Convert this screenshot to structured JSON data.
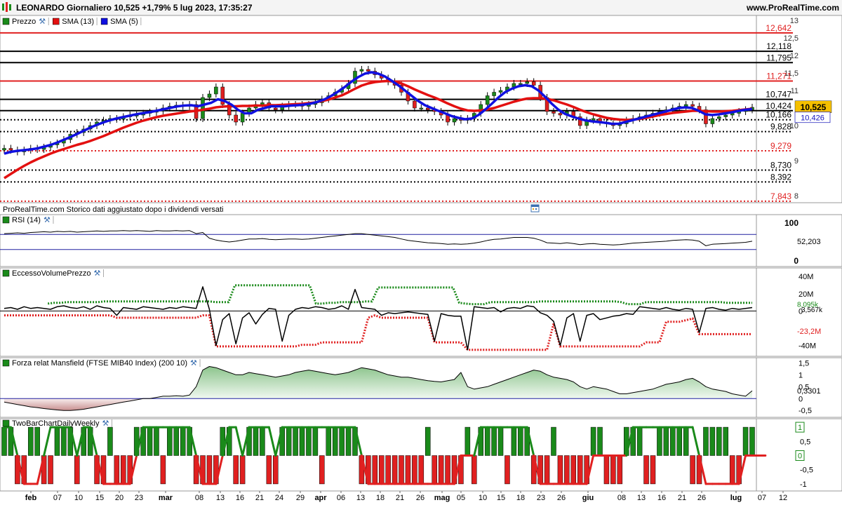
{
  "header": {
    "title": "LEONARDO Giornaliero 10,525 +1,79% 5 lug 2023, 17:35:27",
    "site": "www.ProRealTime.com"
  },
  "footer_note": "ProRealTime.com  Storico dati aggiustato dopo i dividendi versati",
  "x_axis_labels": [
    "feb",
    "07",
    "10",
    "15",
    "20",
    "23",
    "mar",
    "08",
    "13",
    "16",
    "21",
    "24",
    "29",
    "apr",
    "06",
    "13",
    "18",
    "21",
    "26",
    "mag",
    "05",
    "10",
    "15",
    "18",
    "23",
    "26",
    "giu",
    "08",
    "13",
    "16",
    "21",
    "26",
    "lug",
    "07",
    "12"
  ],
  "colors": {
    "up": "#1a8a1a",
    "down": "#e02020",
    "sma13": "#e31010",
    "sma5": "#1010e0",
    "accent": "#f5c000"
  },
  "chart_data": [
    {
      "type": "candlestick",
      "panel": "price",
      "legend": [
        {
          "name": "Prezzo"
        },
        {
          "name": "SMA (13)",
          "color": "#e31010"
        },
        {
          "name": "SMA (5)",
          "color": "#1010e0"
        }
      ],
      "y_ticks": [
        "13",
        "12,5",
        "12",
        "11,5",
        "11",
        "10",
        "9",
        "8"
      ],
      "ylim": [
        7.8,
        13.1
      ],
      "levels": [
        {
          "value": 12.642,
          "label": "12,642",
          "color": "#e02020",
          "style": "solid"
        },
        {
          "value": 12.118,
          "label": "12,118",
          "color": "#000",
          "style": "solid"
        },
        {
          "value": 11.795,
          "label": "11,795",
          "color": "#000",
          "style": "solid"
        },
        {
          "value": 11.271,
          "label": "11,271",
          "color": "#e02020",
          "style": "solid"
        },
        {
          "value": 10.747,
          "label": "10,747",
          "color": "#000",
          "style": "solid"
        },
        {
          "value": 10.424,
          "label": "10,424",
          "color": "#000",
          "style": "solid"
        },
        {
          "value": 10.166,
          "label": "10,166",
          "color": "#000",
          "style": "dotted"
        },
        {
          "value": 9.828,
          "label": "9,828",
          "color": "#000",
          "style": "dotted"
        },
        {
          "value": 9.279,
          "label": "9,279",
          "color": "#e02020",
          "style": "dotted"
        },
        {
          "value": 8.73,
          "label": "8,730",
          "color": "#000",
          "style": "dotted"
        },
        {
          "value": 8.392,
          "label": "8,392",
          "color": "#000",
          "style": "dotted"
        },
        {
          "value": 7.843,
          "label": "7,843",
          "color": "#e02020",
          "style": "dotted"
        }
      ],
      "last_price": {
        "value": 10.525,
        "label": "10,525"
      },
      "sma5_last": {
        "value": 10.426,
        "label": "10,426"
      },
      "close": [
        9.35,
        9.3,
        9.25,
        9.3,
        9.35,
        9.32,
        9.38,
        9.45,
        9.5,
        9.6,
        9.75,
        9.8,
        9.9,
        10.0,
        10.1,
        10.15,
        10.2,
        10.18,
        10.25,
        10.3,
        10.3,
        10.35,
        10.38,
        10.42,
        10.5,
        10.55,
        10.58,
        10.55,
        10.6,
        10.2,
        10.8,
        10.9,
        11.1,
        10.6,
        10.3,
        10.1,
        10.35,
        10.5,
        10.6,
        10.65,
        10.5,
        10.45,
        10.55,
        10.6,
        10.6,
        10.55,
        10.6,
        10.65,
        10.75,
        10.85,
        10.95,
        11.05,
        11.2,
        11.55,
        11.6,
        11.55,
        11.45,
        11.35,
        11.25,
        11.15,
        10.95,
        10.7,
        10.5,
        10.5,
        10.45,
        10.4,
        10.3,
        10.1,
        10.2,
        10.15,
        10.2,
        10.35,
        10.6,
        10.85,
        10.95,
        11.0,
        11.1,
        11.2,
        11.2,
        11.25,
        11.15,
        10.8,
        10.4,
        10.35,
        10.3,
        10.4,
        10.25,
        10.0,
        10.15,
        10.2,
        10.1,
        10.05,
        10.0,
        10.05,
        10.15,
        10.2,
        10.25,
        10.3,
        10.35,
        10.4,
        10.45,
        10.5,
        10.55,
        10.6,
        10.55,
        10.45,
        10.05,
        10.2,
        10.25,
        10.3,
        10.35,
        10.4,
        10.45,
        10.52
      ],
      "sma13": [
        8.5,
        8.62,
        8.74,
        8.85,
        8.95,
        9.04,
        9.12,
        9.2,
        9.27,
        9.33,
        9.39,
        9.45,
        9.5,
        9.56,
        9.63,
        9.7,
        9.78,
        9.86,
        9.94,
        10.01,
        10.08,
        10.14,
        10.19,
        10.24,
        10.28,
        10.31,
        10.34,
        10.37,
        10.4,
        10.42,
        10.45,
        10.48,
        10.52,
        10.54,
        10.55,
        10.55,
        10.56,
        10.56,
        10.57,
        10.57,
        10.58,
        10.58,
        10.59,
        10.6,
        10.61,
        10.62,
        10.64,
        10.66,
        10.7,
        10.74,
        10.8,
        10.86,
        10.95,
        11.05,
        11.14,
        11.2,
        11.24,
        11.26,
        11.27,
        11.25,
        11.2,
        11.12,
        11.03,
        10.95,
        10.87,
        10.8,
        10.72,
        10.63,
        10.55,
        10.48,
        10.43,
        10.42,
        10.43,
        10.46,
        10.5,
        10.56,
        10.62,
        10.68,
        10.73,
        10.77,
        10.78,
        10.78,
        10.76,
        10.72,
        10.66,
        10.6,
        10.53,
        10.45,
        10.38,
        10.32,
        10.27,
        10.22,
        10.19,
        10.17,
        10.16,
        10.17,
        10.19,
        10.22,
        10.26,
        10.3,
        10.33,
        10.36,
        10.38,
        10.4,
        10.42,
        10.42,
        10.41,
        10.4,
        10.4,
        10.41,
        10.42,
        10.44,
        10.46,
        10.48
      ],
      "sma5": [
        9.2,
        9.25,
        9.28,
        9.3,
        9.32,
        9.35,
        9.4,
        9.45,
        9.52,
        9.6,
        9.68,
        9.77,
        9.86,
        9.95,
        10.03,
        10.1,
        10.16,
        10.21,
        10.25,
        10.29,
        10.33,
        10.36,
        10.39,
        10.43,
        10.47,
        10.51,
        10.55,
        10.57,
        10.58,
        10.55,
        10.6,
        10.65,
        10.75,
        10.7,
        10.6,
        10.45,
        10.35,
        10.35,
        10.45,
        10.5,
        10.55,
        10.55,
        10.55,
        10.57,
        10.58,
        10.6,
        10.63,
        10.68,
        10.75,
        10.85,
        10.97,
        11.1,
        11.25,
        11.38,
        11.48,
        11.52,
        11.48,
        11.4,
        11.28,
        11.15,
        11.0,
        10.85,
        10.7,
        10.58,
        10.5,
        10.42,
        10.35,
        10.27,
        10.22,
        10.18,
        10.2,
        10.3,
        10.45,
        10.62,
        10.8,
        10.95,
        11.05,
        11.12,
        11.15,
        11.12,
        11.0,
        10.82,
        10.62,
        10.45,
        10.33,
        10.26,
        10.2,
        10.15,
        10.12,
        10.1,
        10.08,
        10.05,
        10.05,
        10.1,
        10.15,
        10.2,
        10.25,
        10.3,
        10.35,
        10.4,
        10.45,
        10.5,
        10.52,
        10.5,
        10.42,
        10.32,
        10.3,
        10.32,
        10.35,
        10.38,
        10.42,
        10.45,
        10.47
      ]
    },
    {
      "type": "line",
      "panel": "rsi",
      "legend": [
        {
          "name": "RSI (14)"
        }
      ],
      "y_ticks": [
        "100",
        "0"
      ],
      "ylim": [
        0,
        100
      ],
      "bands": [
        70,
        30
      ],
      "last": {
        "value": 52.203,
        "label": "52,203"
      },
      "values": [
        72,
        73,
        74,
        73,
        75,
        76,
        77,
        76,
        78,
        77,
        78,
        76,
        77,
        78,
        79,
        78,
        79,
        79,
        80,
        79,
        80,
        79,
        78,
        80,
        79,
        79,
        80,
        79,
        80,
        72,
        75,
        60,
        55,
        52,
        50,
        52,
        55,
        58,
        58,
        59,
        57,
        56,
        57,
        58,
        58,
        57,
        58,
        60,
        62,
        64,
        66,
        68,
        70,
        72,
        72,
        70,
        68,
        66,
        64,
        62,
        58,
        54,
        52,
        50,
        48,
        47,
        46,
        44,
        45,
        44,
        45,
        47,
        50,
        54,
        57,
        58,
        60,
        62,
        62,
        62,
        60,
        55,
        48,
        47,
        46,
        48,
        46,
        43,
        45,
        46,
        44,
        43,
        42,
        43,
        45,
        47,
        48,
        49,
        50,
        51,
        52,
        54,
        55,
        56,
        55,
        52,
        40,
        44,
        45,
        46,
        47,
        48,
        49,
        52
      ]
    },
    {
      "type": "line",
      "panel": "volume_excess",
      "legend": [
        {
          "name": "EccessoVolumePrezzo"
        }
      ],
      "y_ticks": [
        "40M",
        "20M",
        "0",
        "-40M"
      ],
      "ylim": [
        -50,
        45
      ],
      "labels": {
        "upper": "8,095k",
        "mid": "3,567k",
        "zero": "0",
        "lower": "-23,2M"
      },
      "values": [
        3,
        4,
        2,
        5,
        3,
        4,
        3,
        2,
        5,
        6,
        4,
        3,
        5,
        2,
        6,
        4,
        3,
        -5,
        4,
        3,
        2,
        5,
        4,
        3,
        2,
        4,
        3,
        5,
        4,
        3,
        28,
        2,
        -40,
        -10,
        -3,
        -38,
        -8,
        -2,
        -15,
        -4,
        3,
        2,
        -35,
        -5,
        2,
        4,
        3,
        5,
        4,
        2,
        3,
        6,
        2,
        25,
        4,
        3,
        2,
        -5,
        -2,
        -3,
        -2,
        -1,
        -2,
        -3,
        -4,
        -35,
        -3,
        -5,
        -6,
        -6,
        -45,
        5,
        4,
        3,
        4,
        -1,
        3,
        4,
        3,
        6,
        5,
        -2,
        -5,
        -12,
        -40,
        -8,
        -3,
        -35,
        -5,
        -3,
        -10,
        -8,
        -6,
        -5,
        -3,
        -4,
        5,
        4,
        3,
        2,
        4,
        2,
        1,
        3,
        2,
        -25,
        3,
        4,
        2,
        1,
        3,
        2,
        3,
        4
      ]
    },
    {
      "type": "area",
      "panel": "mansfield",
      "legend": [
        {
          "name": "Forza relat Mansfield (FTSE MIB40 Index) (200 10)"
        }
      ],
      "y_ticks": [
        "1,5",
        "1",
        "0,5",
        "0",
        "-0,5"
      ],
      "ylim": [
        -0.7,
        1.6
      ],
      "last": {
        "value": 0.3301,
        "label": "0,3301"
      },
      "values": [
        -0.15,
        -0.2,
        -0.25,
        -0.3,
        -0.35,
        -0.38,
        -0.42,
        -0.45,
        -0.48,
        -0.5,
        -0.5,
        -0.48,
        -0.45,
        -0.4,
        -0.35,
        -0.3,
        -0.25,
        -0.2,
        -0.15,
        -0.1,
        -0.05,
        0.0,
        0.0,
        0.05,
        0.1,
        0.1,
        0.12,
        0.1,
        0.15,
        0.5,
        1.2,
        1.35,
        1.3,
        1.2,
        1.1,
        1.0,
        1.0,
        1.1,
        1.05,
        1.0,
        0.95,
        0.9,
        0.95,
        1.0,
        1.1,
        1.15,
        1.2,
        1.15,
        1.1,
        1.05,
        1.0,
        1.05,
        1.1,
        1.2,
        1.3,
        1.25,
        1.2,
        1.1,
        1.0,
        0.95,
        0.9,
        0.9,
        0.85,
        0.8,
        0.75,
        0.72,
        0.7,
        0.75,
        0.8,
        1.1,
        0.5,
        0.4,
        0.45,
        0.5,
        0.6,
        0.7,
        0.8,
        0.9,
        1.0,
        1.1,
        1.2,
        1.15,
        1.0,
        0.9,
        0.85,
        0.8,
        0.7,
        0.5,
        0.4,
        0.5,
        0.45,
        0.4,
        0.3,
        0.2,
        0.2,
        0.25,
        0.3,
        0.35,
        0.4,
        0.5,
        0.6,
        0.65,
        0.7,
        0.8,
        0.85,
        0.7,
        0.5,
        0.4,
        0.35,
        0.3,
        0.2,
        0.15,
        0.1,
        0.33
      ]
    },
    {
      "type": "bar",
      "panel": "twobar",
      "legend": [
        {
          "name": "TwoBarChartDailyWeekly"
        }
      ],
      "y_ticks": [
        "1",
        "0,5",
        "0",
        "-0,5",
        "-1"
      ],
      "ylim": [
        -1.2,
        1.2
      ],
      "labels": {
        "top": "1",
        "mid": "0"
      },
      "daily": [
        1,
        1,
        -1,
        -1,
        1,
        1,
        -1,
        -1,
        1,
        1,
        1,
        -1,
        1,
        1,
        -1,
        -1,
        1,
        -1,
        -1,
        -1,
        1,
        1,
        1,
        1,
        -1,
        1,
        1,
        1,
        1,
        -1,
        -1,
        -1,
        -1,
        1,
        1,
        -1,
        -1,
        1,
        1,
        1,
        -1,
        -1,
        1,
        1,
        1,
        1,
        1,
        1,
        -1,
        1,
        1,
        1,
        1,
        1,
        -1,
        -1,
        -1,
        -1,
        -1,
        -1,
        -1,
        -1,
        -1,
        -1,
        1,
        -1,
        -1,
        -1,
        -1,
        -1,
        1,
        -1,
        1,
        1,
        1,
        1,
        -1,
        1,
        1,
        1,
        -1,
        -1,
        -1,
        1,
        -1,
        -1,
        -1,
        -1,
        -1,
        1,
        1,
        -1,
        -1,
        -1,
        1,
        1,
        1,
        -1,
        -1,
        1,
        1,
        1,
        1,
        1,
        -1,
        -1,
        1,
        1,
        1,
        1,
        -1,
        -1,
        1,
        1
      ],
      "weekly": [
        1,
        1,
        0,
        -1,
        -1,
        -1,
        0,
        1,
        1,
        1,
        1,
        0,
        1,
        1,
        0,
        -1,
        -1,
        -1,
        -1,
        -1,
        0,
        1,
        1,
        1,
        1,
        1,
        1,
        1,
        1,
        0,
        -1,
        -1,
        -1,
        0,
        1,
        1,
        0,
        1,
        1,
        1,
        1,
        0,
        1,
        1,
        1,
        1,
        1,
        1,
        1,
        1,
        1,
        1,
        1,
        1,
        0,
        -1,
        -1,
        -1,
        -1,
        -1,
        -1,
        -1,
        -1,
        -1,
        -1,
        -1,
        -1,
        -1,
        -1,
        0,
        0,
        0,
        1,
        1,
        1,
        1,
        1,
        1,
        1,
        1,
        0,
        -1,
        -1,
        -1,
        -1,
        -1,
        -1,
        -1,
        -1,
        0,
        0,
        0,
        0,
        0,
        0,
        1,
        1,
        1,
        1,
        1,
        1,
        1,
        1,
        1,
        1,
        0,
        -1,
        -1,
        -1,
        -1,
        -1,
        -1,
        0,
        0,
        0,
        0
      ]
    }
  ]
}
